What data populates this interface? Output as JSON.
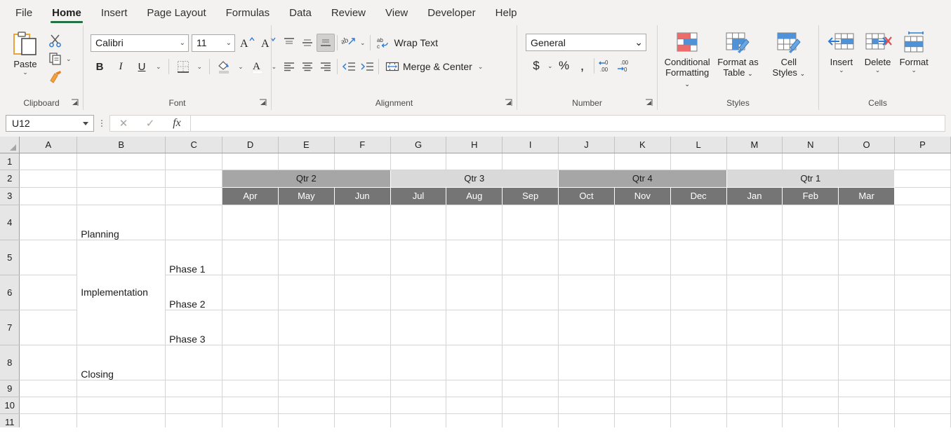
{
  "app": {
    "tabs": [
      {
        "label": "File",
        "active": false
      },
      {
        "label": "Home",
        "active": true
      },
      {
        "label": "Insert",
        "active": false
      },
      {
        "label": "Page Layout",
        "active": false
      },
      {
        "label": "Formulas",
        "active": false
      },
      {
        "label": "Data",
        "active": false
      },
      {
        "label": "Review",
        "active": false
      },
      {
        "label": "View",
        "active": false
      },
      {
        "label": "Developer",
        "active": false
      },
      {
        "label": "Help",
        "active": false
      }
    ],
    "accent_green": "#217346"
  },
  "ribbon": {
    "clipboard": {
      "label": "Clipboard",
      "paste_label": "Paste",
      "cut_icon": "scissors-icon",
      "copy_icon": "copy-icon",
      "format_painter_icon": "format-painter-icon"
    },
    "font": {
      "label": "Font",
      "font_name": "Calibri",
      "font_size": "11",
      "grow_font": "A",
      "shrink_font": "A",
      "bold": "B",
      "italic": "I",
      "underline": "U",
      "borders_icon": "borders-icon",
      "fill_color_icon": "fill-color-icon",
      "font_color_icon": "font-color-icon"
    },
    "alignment": {
      "label": "Alignment",
      "top_align_icon": "align-top-icon",
      "middle_align_icon": "align-middle-icon",
      "bottom_align_icon": "align-bottom-icon",
      "orientation_icon": "orientation-icon",
      "wrap_text": "Wrap Text",
      "align_left_icon": "align-left-icon",
      "align_center_icon": "align-center-icon",
      "align_right_icon": "align-right-icon",
      "decrease_indent_icon": "decrease-indent-icon",
      "increase_indent_icon": "increase-indent-icon",
      "merge_center": "Merge & Center"
    },
    "number": {
      "label": "Number",
      "format": "General",
      "currency": "$",
      "percent": "%",
      "comma": ",",
      "increase_decimal_icon": "increase-decimal-icon",
      "decrease_decimal_icon": "decrease-decimal-icon"
    },
    "styles": {
      "label": "Styles",
      "conditional_formatting": "Conditional\nFormatting",
      "conditional_formatting_l1": "Conditional",
      "conditional_formatting_l2": "Formatting",
      "format_as_table_l1": "Format as",
      "format_as_table_l2": "Table",
      "cell_styles_l1": "Cell",
      "cell_styles_l2": "Styles"
    },
    "cells": {
      "label": "Cells",
      "insert": "Insert",
      "delete": "Delete",
      "format": "Format"
    }
  },
  "formula_bar": {
    "name_box": "U12",
    "cancel_icon": "cancel-icon",
    "enter_icon": "confirm-check-icon",
    "fx_icon": "fx-icon",
    "formula_value": ""
  },
  "sheet": {
    "columns": [
      "A",
      "B",
      "C",
      "D",
      "E",
      "F",
      "G",
      "H",
      "I",
      "J",
      "K",
      "L",
      "M",
      "N",
      "O",
      "P"
    ],
    "rows": [
      "1",
      "2",
      "3",
      "4",
      "5",
      "6",
      "7",
      "8",
      "9",
      "10",
      "11"
    ],
    "quarters": [
      {
        "name": "Qtr 2",
        "shade": "dark",
        "months": [
          "Apr",
          "May",
          "Jun"
        ]
      },
      {
        "name": "Qtr 3",
        "shade": "light",
        "months": [
          "Jul",
          "Aug",
          "Sep"
        ]
      },
      {
        "name": "Qtr 4",
        "shade": "dark",
        "months": [
          "Oct",
          "Nov",
          "Dec"
        ]
      },
      {
        "name": "Qtr 1",
        "shade": "light",
        "months": [
          "Jan",
          "Feb",
          "Mar"
        ]
      }
    ],
    "tasks": {
      "planning": "Planning",
      "implementation": "Implementation",
      "closing": "Closing",
      "phase1": "Phase 1",
      "phase2": "Phase 2",
      "phase3": "Phase 3"
    },
    "colors": {
      "qtr_dark": "#a6a6a6",
      "qtr_light": "#d9d9d9",
      "month_fill": "#757575",
      "month_text": "#ffffff",
      "header_fill": "#e6e6e6",
      "gridline": "#d4d4d4"
    }
  }
}
